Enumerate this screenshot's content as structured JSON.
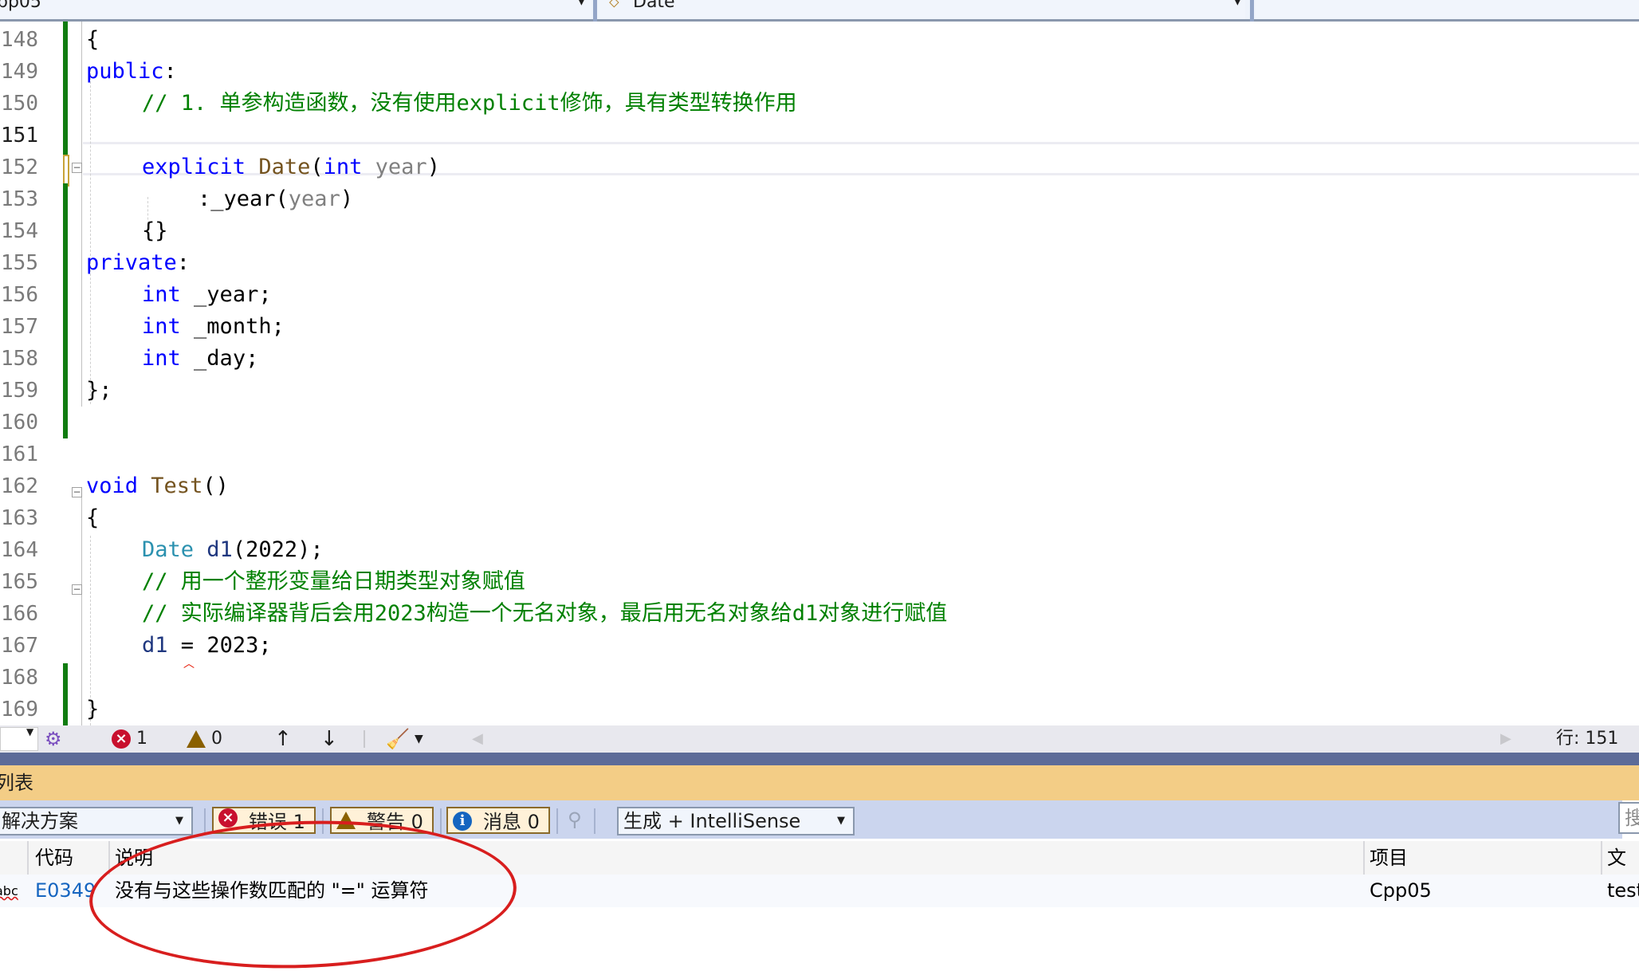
{
  "nav": {
    "project_dropdown": "pp05",
    "class_dropdown": "Date",
    "class_icon": "class-icon"
  },
  "editor": {
    "current_line": 151,
    "lines": [
      {
        "num": "148",
        "text": "{"
      },
      {
        "num": "149",
        "text": "public:"
      },
      {
        "num": "150",
        "text": "    // 1. 单参构造函数，没有使用explicit修饰，具有类型转换作用"
      },
      {
        "num": "151",
        "text": ""
      },
      {
        "num": "152",
        "text": "    explicit Date(int year)"
      },
      {
        "num": "153",
        "text": "        :_year(year)"
      },
      {
        "num": "154",
        "text": "    {}"
      },
      {
        "num": "155",
        "text": "private:"
      },
      {
        "num": "156",
        "text": "    int _year;"
      },
      {
        "num": "157",
        "text": "    int _month;"
      },
      {
        "num": "158",
        "text": "    int _day;"
      },
      {
        "num": "159",
        "text": "};"
      },
      {
        "num": "160",
        "text": ""
      },
      {
        "num": "161",
        "text": ""
      },
      {
        "num": "162",
        "text": "void Test()"
      },
      {
        "num": "163",
        "text": "{"
      },
      {
        "num": "164",
        "text": "    Date d1(2022);"
      },
      {
        "num": "165",
        "text": "    // 用一个整形变量给日期类型对象赋值"
      },
      {
        "num": "166",
        "text": "    // 实际编译器背后会用2023构造一个无名对象，最后用无名对象给d1对象进行赋值"
      },
      {
        "num": "167",
        "text": "    d1 = 2023;"
      },
      {
        "num": "168",
        "text": ""
      },
      {
        "num": "169",
        "text": "}"
      }
    ],
    "tokens": {
      "l148": "{",
      "l149_kw": "public",
      "l149_p": ":",
      "l150": "// 1. 单参构造函数，没有使用explicit修饰，具有类型转换作用",
      "l152_kw": "explicit",
      "l152_fn": "Date",
      "l152_p1": "(",
      "l152_kw2": "int",
      "l152_pr": "year",
      "l152_p2": ")",
      "l153_a": ":_year(",
      "l153_pr": "year",
      "l153_b": ")",
      "l154": "{}",
      "l155_kw": "private",
      "l155_p": ":",
      "l156_kw": "int",
      "l156_v": "_year;",
      "l157_kw": "int",
      "l157_v": "_month;",
      "l158_kw": "int",
      "l158_v": "_day;",
      "l159": "};",
      "l162_kw": "void",
      "l162_fn": "Test",
      "l162_p": "()",
      "l163": "{",
      "l164_ty": "Date",
      "l164_v": "d1",
      "l164_p": "(2022);",
      "l165": "// 用一个整形变量给日期类型对象赋值",
      "l166": "// 实际编译器背后会用2023构造一个无名对象，最后用无名对象给d1对象进行赋值",
      "l167_v": "d1",
      "l167_op": "=",
      "l167_p": "2023;",
      "l169": "}"
    }
  },
  "statusbar": {
    "errors": "1",
    "warnings": "0",
    "up_arrow": "↑",
    "down_arrow": "↓",
    "line_indicator": "行: 151"
  },
  "error_list": {
    "title": "列表",
    "scope_dropdown": "解决方案",
    "filter_errors": "错误 1",
    "filter_warnings": "警告 0",
    "filter_messages": "消息 0",
    "source_dropdown": "生成 + IntelliSense",
    "search_placeholder": "搜",
    "columns": {
      "code": "代码",
      "description": "说明",
      "project": "项目",
      "file": "文件"
    },
    "rows": [
      {
        "type_icon": "abc",
        "code": "E0349",
        "description": "没有与这些操作数匹配的 \"=\" 运算符",
        "project": "Cpp05",
        "file": "test"
      }
    ]
  },
  "colors": {
    "keyword": "#0000ff",
    "type": "#2b91af",
    "comment": "#008000",
    "error_list_title_bg": "#f3cd86",
    "annotation": "#d81e1e"
  }
}
